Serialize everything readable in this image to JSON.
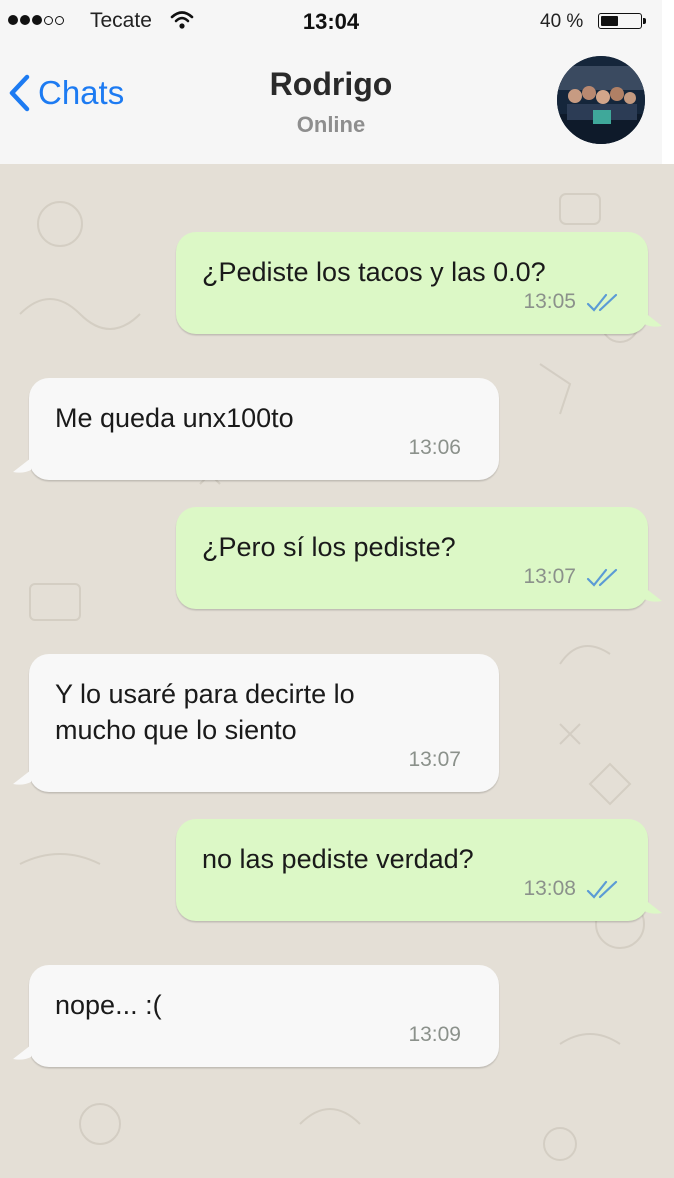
{
  "status_bar": {
    "carrier": "Tecate",
    "time": "13:04",
    "battery_percent": "40 %",
    "battery_level": 0.4
  },
  "header": {
    "back_label": "Chats",
    "contact_name": "Rodrigo",
    "contact_status": "Online"
  },
  "colors": {
    "accent": "#1d7bf2",
    "outgoing_bubble": "#dcf8c6",
    "incoming_bubble": "#f8f8f8",
    "read_ticks": "#5b9bd5"
  },
  "messages": [
    {
      "direction": "out",
      "text": "¿Pediste los tacos y las 0.0?",
      "time": "13:05",
      "status": "read"
    },
    {
      "direction": "in",
      "text": "Me queda unx100to",
      "time": "13:06"
    },
    {
      "direction": "out",
      "text": "¿Pero sí los pediste?",
      "time": "13:07",
      "status": "read"
    },
    {
      "direction": "in",
      "text": "Y lo usaré para decirte lo mucho que lo siento",
      "time": "13:07"
    },
    {
      "direction": "out",
      "text": "no las pediste verdad?",
      "time": "13:08",
      "status": "read"
    },
    {
      "direction": "in",
      "text": "nope... :(",
      "time": "13:09"
    }
  ]
}
